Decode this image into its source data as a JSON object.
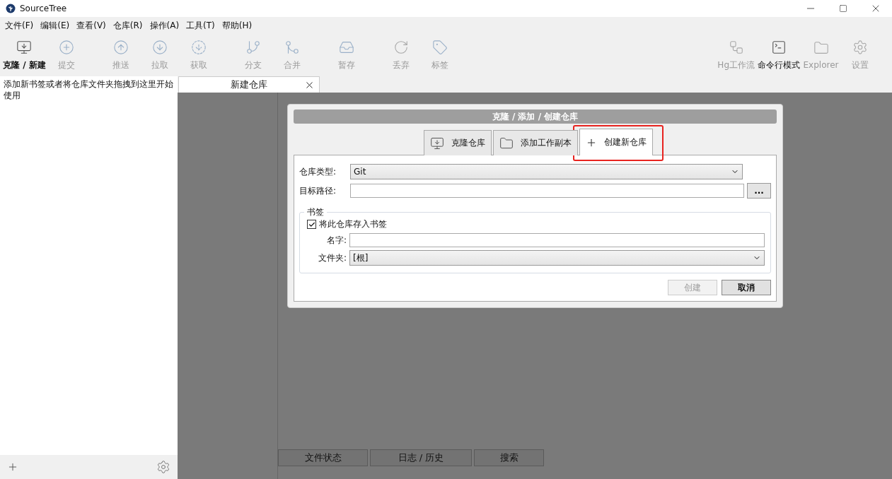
{
  "window": {
    "title": "SourceTree"
  },
  "menu": [
    "文件(F)",
    "编辑(E)",
    "查看(V)",
    "仓库(R)",
    "操作(A)",
    "工具(T)",
    "帮助(H)"
  ],
  "toolbar_left": [
    {
      "label": "克隆 / 新建",
      "disabled": false
    },
    {
      "label": "提交",
      "disabled": true
    },
    {
      "label": "推送",
      "disabled": true
    },
    {
      "label": "拉取",
      "disabled": true
    },
    {
      "label": "获取",
      "disabled": true
    },
    {
      "label": "分支",
      "disabled": true
    },
    {
      "label": "合并",
      "disabled": true
    },
    {
      "label": "暂存",
      "disabled": true
    },
    {
      "label": "丢弃",
      "disabled": true
    },
    {
      "label": "标签",
      "disabled": true
    }
  ],
  "toolbar_right": [
    {
      "label": "Hg工作流",
      "disabled": true
    },
    {
      "label": "命令行模式",
      "disabled": false
    },
    {
      "label": "Explorer",
      "disabled": true
    },
    {
      "label": "设置",
      "disabled": true
    }
  ],
  "sidebar": {
    "hint": "添加新书签或者将仓库文件夹拖拽到这里开始使用"
  },
  "document_tab": {
    "label": "新建仓库"
  },
  "dialog": {
    "title": "克隆 / 添加 / 创建仓库",
    "tabs": [
      {
        "label": "克隆仓库",
        "selected": false,
        "highlighted": false
      },
      {
        "label": "添加工作副本",
        "selected": false,
        "highlighted": false
      },
      {
        "label": "创建新仓库",
        "selected": true,
        "highlighted": true
      }
    ],
    "repo_type": {
      "label": "仓库类型:",
      "value": "Git"
    },
    "target_path": {
      "label": "目标路径:",
      "browse": "..."
    },
    "bookmark": {
      "legend": "书签",
      "save_checkbox": {
        "label": "将此仓库存入书签",
        "checked": true
      },
      "name": {
        "label": "名字:"
      },
      "folder": {
        "label": "文件夹:",
        "value": "[根]"
      }
    },
    "buttons": [
      {
        "label": "创建",
        "disabled": true
      },
      {
        "label": "取消",
        "disabled": false
      }
    ]
  },
  "bottom_tabs": [
    "文件状态",
    "日志 / 历史",
    "搜索"
  ]
}
